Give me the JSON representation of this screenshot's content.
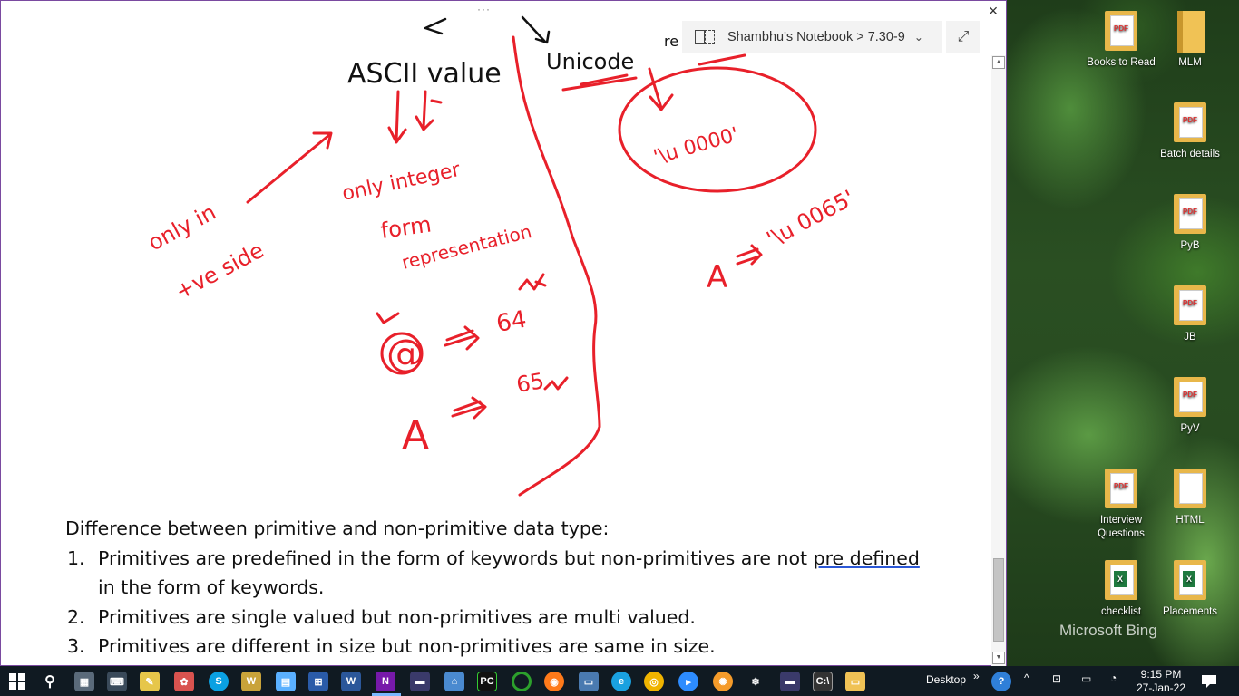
{
  "window": {
    "grip": "···",
    "close_label": "×",
    "breadcrumb": "Shambhu's Notebook > 7.30-9",
    "expand_label": "⤢"
  },
  "ink_words": {
    "ascii": "ASCII value",
    "unicode": "Unicode",
    "re": "re",
    "only_int": "only integer",
    "form": "form",
    "representation": "representation",
    "only_in": "only in",
    "ve_side": "+ve side",
    "u0000": "'\\u 0000'",
    "at": "@",
    "at_val": "64",
    "a1": "A",
    "a1_val": "65",
    "a2": "A",
    "u0065": "'\\u 0065'"
  },
  "note": {
    "heading": "Difference between primitive and non-primitive data type:",
    "items": [
      {
        "num": "1.",
        "pre": "Primitives are predefined in the form of keywords but non-primitives are not ",
        "underlined": "pre defined",
        "post": " in the form of keywords."
      },
      {
        "num": "2.",
        "text": "Primitives are single valued but non-primitives are multi valued."
      },
      {
        "num": "3.",
        "text": "Primitives are different in size but non-primitives are same in size."
      }
    ]
  },
  "desktop": {
    "icons": [
      {
        "label": "Books to Read",
        "kind": "pdf-folder"
      },
      {
        "label": "MLM",
        "kind": "folder"
      },
      {
        "label": "Batch details",
        "kind": "pdf-folder"
      },
      {
        "label": "PyB",
        "kind": "pdf"
      },
      {
        "label": "JB",
        "kind": "pdf"
      },
      {
        "label": "PyV",
        "kind": "pdf"
      },
      {
        "label": "Interview Questions",
        "kind": "pdf-folder"
      },
      {
        "label": "HTML",
        "kind": "folder"
      },
      {
        "label": "checklist",
        "kind": "xls"
      },
      {
        "label": "Placements",
        "kind": "xls"
      }
    ],
    "bing": "Microsoft Bing"
  },
  "taskbar": {
    "desktop_label": "Desktop",
    "time": "9:15 PM",
    "date": "27-Jan-22"
  },
  "colors": {
    "ink": "#e8202a",
    "ink_dark": "#111111",
    "accent": "#7a4aa0"
  }
}
